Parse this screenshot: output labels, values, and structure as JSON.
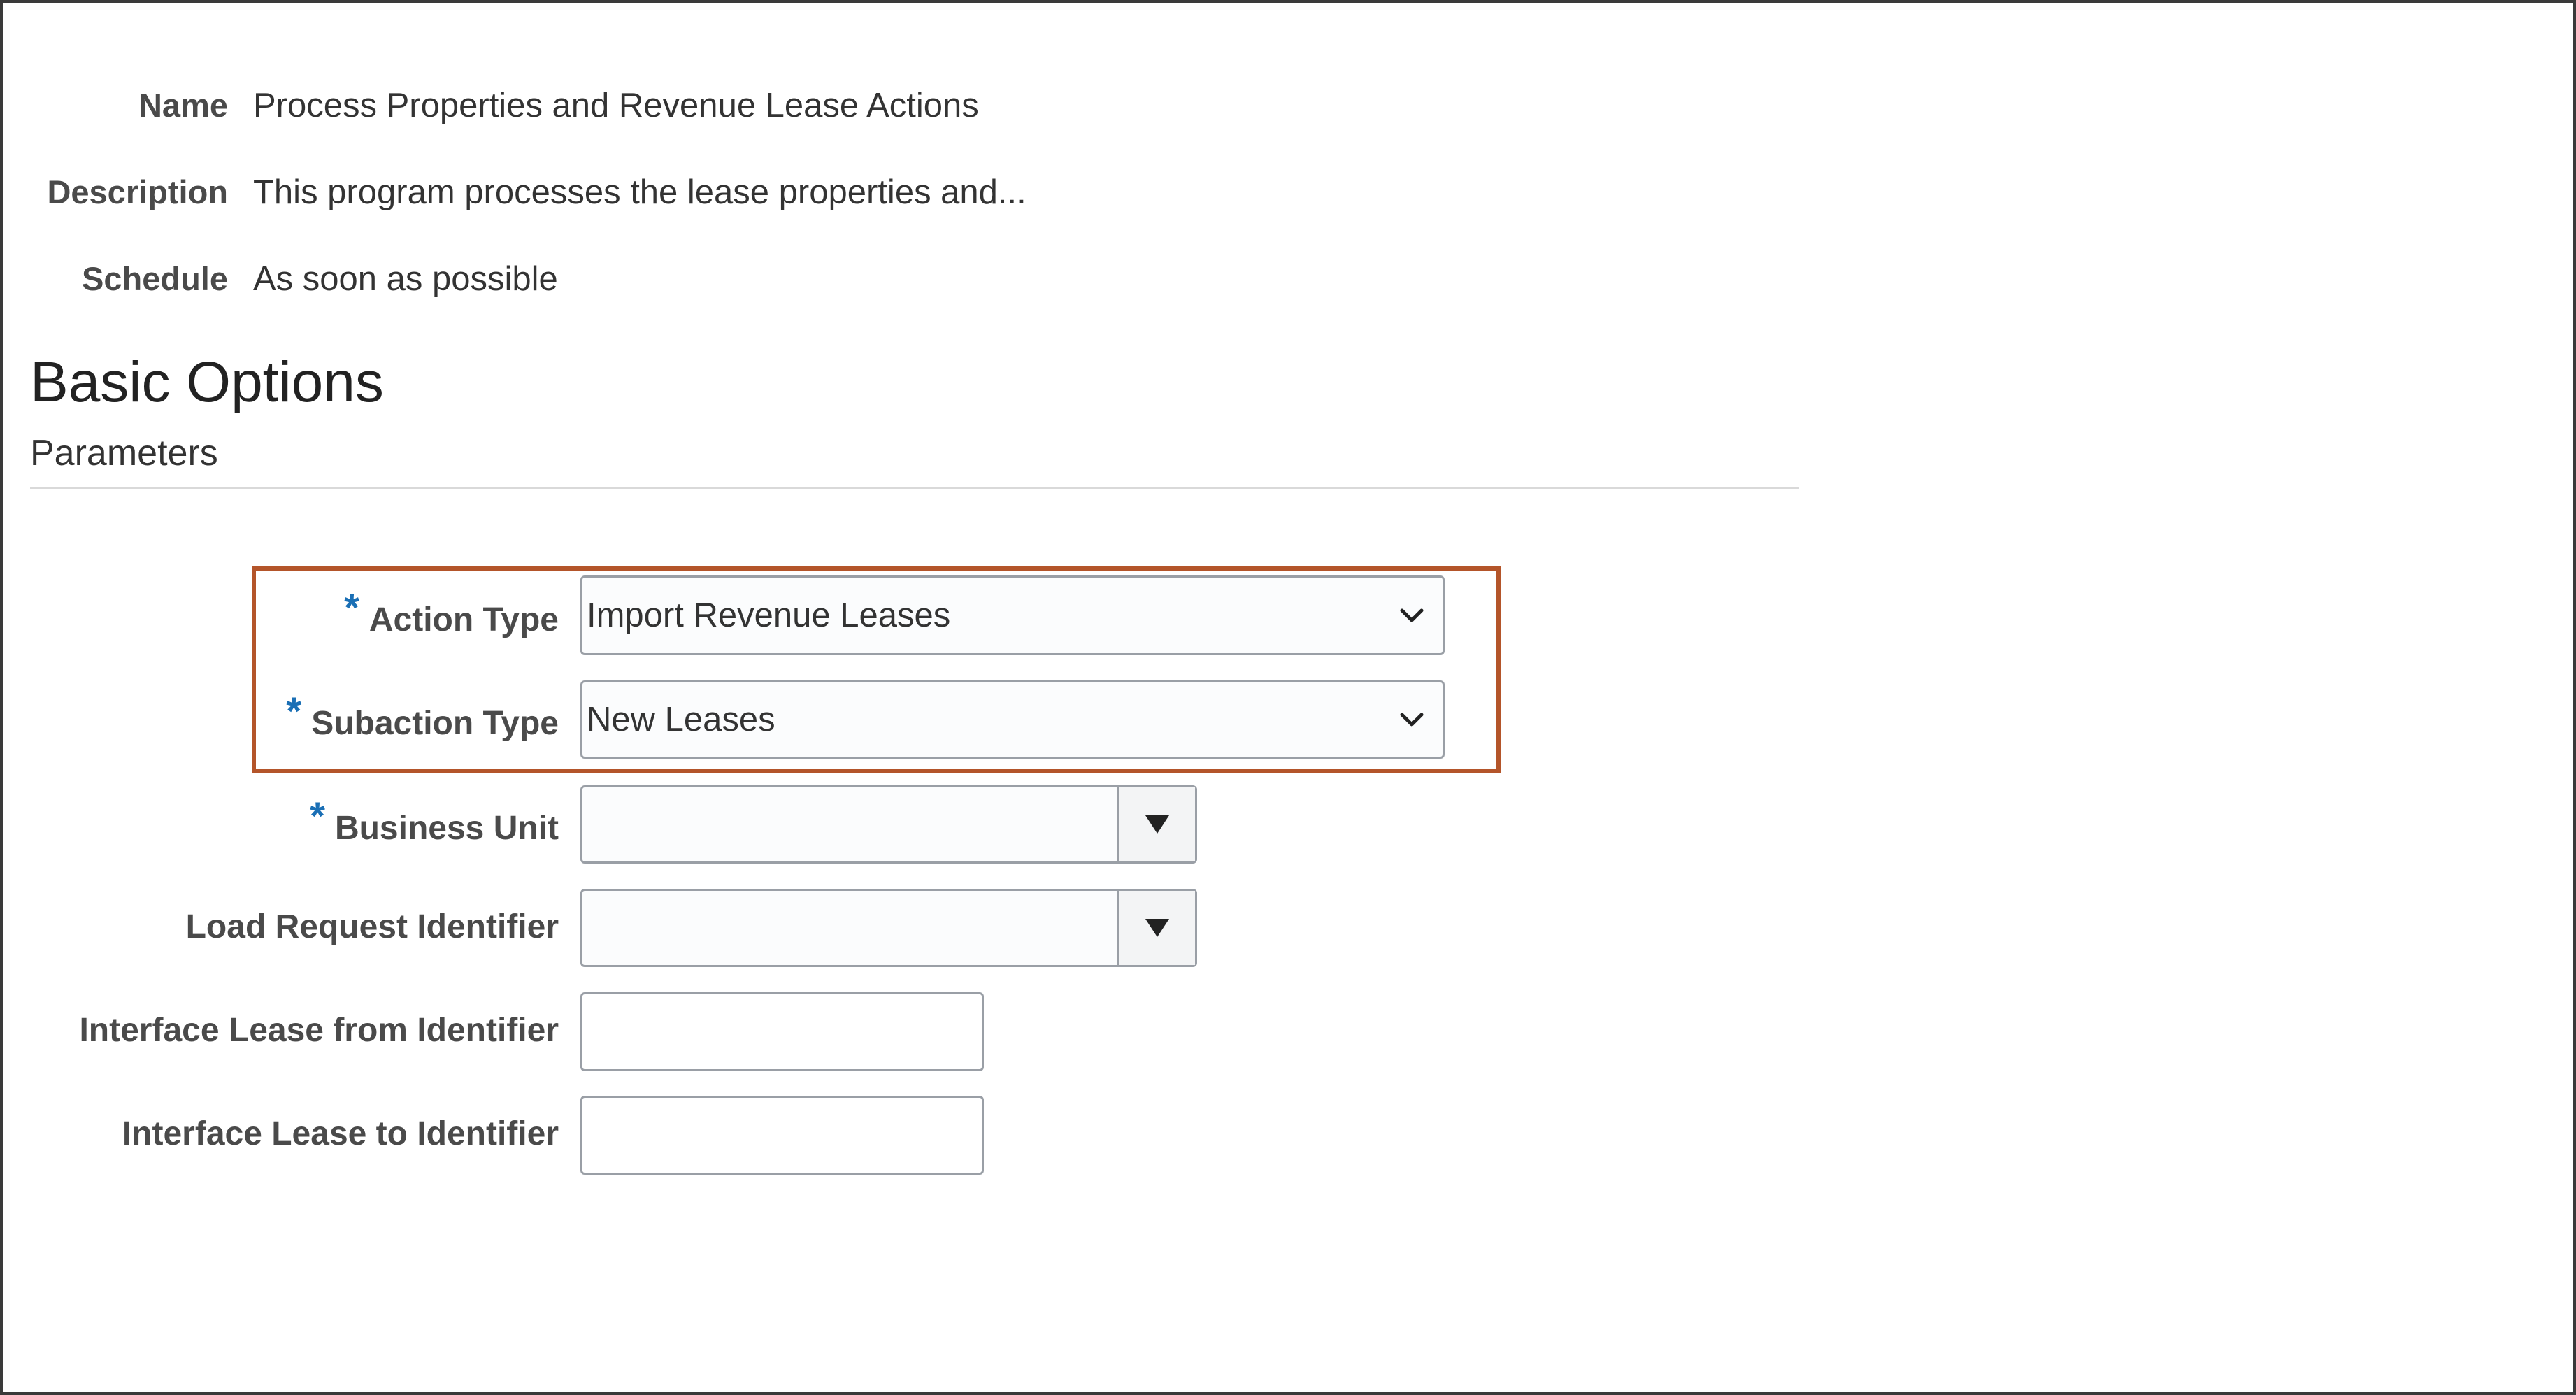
{
  "info": {
    "name_label": "Name",
    "name_value": "Process Properties and Revenue Lease Actions",
    "description_label": "Description",
    "description_value": "This program processes the lease properties and...",
    "schedule_label": "Schedule",
    "schedule_value": "As soon as possible"
  },
  "section": {
    "title": "Basic Options",
    "subtitle": "Parameters"
  },
  "required_marker": "*",
  "params": {
    "action_type": {
      "label": "Action Type",
      "value": "Import Revenue Leases",
      "required": true
    },
    "subaction_type": {
      "label": "Subaction Type",
      "value": "New Leases",
      "required": true
    },
    "business_unit": {
      "label": "Business Unit",
      "value": "",
      "required": true
    },
    "load_request_identifier": {
      "label": "Load Request Identifier",
      "value": ""
    },
    "interface_lease_from": {
      "label": "Interface Lease from Identifier",
      "value": ""
    },
    "interface_lease_to": {
      "label": "Interface Lease to Identifier",
      "value": ""
    }
  },
  "colors": {
    "highlight_border": "#b4552a",
    "required_asterisk": "#1a6fb5"
  },
  "icons": {
    "select_chevron": "chevron-down-icon",
    "combo_arrow": "triangle-down-icon"
  }
}
